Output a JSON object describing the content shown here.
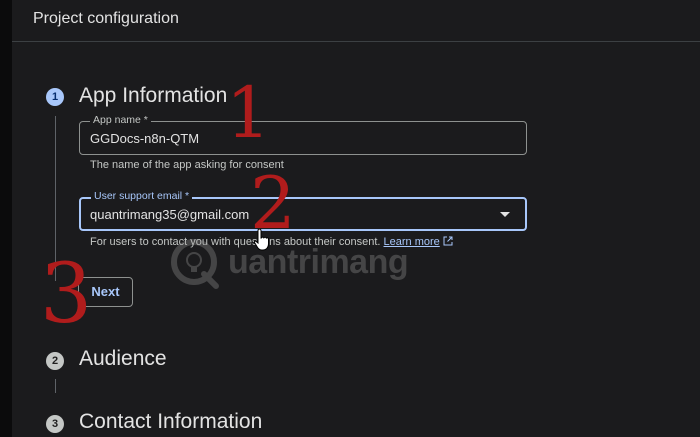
{
  "panel": {
    "title": "Project configuration"
  },
  "steps": [
    {
      "number": "1",
      "title": "App Information",
      "state": "active"
    },
    {
      "number": "2",
      "title": "Audience",
      "state": "inactive"
    },
    {
      "number": "3",
      "title": "Contact Information",
      "state": "inactive"
    }
  ],
  "app_name": {
    "label": "App name *",
    "value": "GGDocs-n8n-QTM",
    "helper": "The name of the app asking for consent"
  },
  "support_email": {
    "label": "User support email *",
    "value": "quantrimang35@gmail.com",
    "helper": "For users to contact you with questions about their consent.",
    "link": "Learn more",
    "link_icon": "external-link-icon"
  },
  "next_button": {
    "label": "Next"
  },
  "annotations": [
    "1",
    "2",
    "3"
  ],
  "watermark": {
    "brand": "uantrimang",
    "logo_icon": "lightbulb-q-logo"
  },
  "colors": {
    "accent": "#a8c7fa",
    "annotation_red": "#b01c1c",
    "background": "#1b1b1d"
  }
}
